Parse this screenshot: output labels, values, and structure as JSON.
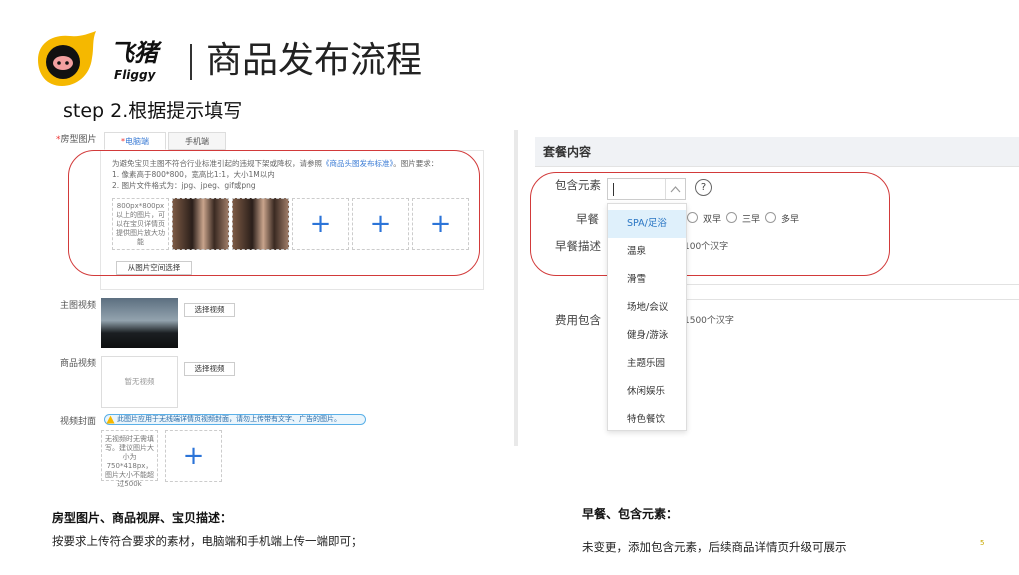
{
  "header": {
    "logo_cn": "飞猪",
    "logo_en": "Fliggy",
    "title": "商品发布流程",
    "step": "step 2.根据提示填写"
  },
  "left_panel": {
    "room_photos_label": "房型图片",
    "required_mark": "*",
    "tabs": [
      "电脑端",
      "手机端"
    ],
    "tab_active_mark": "*",
    "hint_line1_pre": "为避免宝贝主图不符合行业标准引起的违规下架或降权，请参照",
    "hint_link": "《商品头图发布标准》",
    "hint_line1_post": "。图片要求：",
    "hint_line2": "1. 像素高于800*800，宽高比1:1，大小1M以内",
    "hint_line3": "2. 图片文件格式为：jpg、jpeg、gif或png",
    "first_cell_text": "800px*800px以上的图片，可以在宝贝详情页提供图片放大功能",
    "plus_glyph": "+",
    "choose_from_space": "从图片空间选择",
    "main_video_label": "主图视频",
    "choose_video": "选择视频",
    "product_video_label": "商品视频",
    "no_video": "暂无视频",
    "choose_video_2": "选择视频",
    "video_cover_label": "视频封面",
    "warning_text": "此图片应用于无线端详情页视频封面，请勿上传带有文字、广告的图片。",
    "cover_hint": "无视频时无需填写。建议图片大小为750*418px，图片大小不能超过500k"
  },
  "right_panel": {
    "section_title": "套餐内容",
    "include_label": "包含元素",
    "help_glyph": "?",
    "breakfast_label": "早餐",
    "breakfast_options": [
      "双早",
      "三早",
      "多早"
    ],
    "breakfast_desc_label": "早餐描述",
    "breakfast_desc_hint": "100个汉字",
    "fee_label": "费用包含",
    "fee_hint": "1500个汉字",
    "dropdown_items": [
      "SPA/足浴",
      "温泉",
      "滑雪",
      "场地/会议",
      "健身/游泳",
      "主题乐园",
      "休闲娱乐",
      "特色餐饮"
    ],
    "dropdown_selected_index": 0
  },
  "captions": {
    "left_heading": "房型图片、商品视屏、宝贝描述：",
    "left_text": "按要求上传符合要求的素材，电脑端和手机端上传一端即可；",
    "right_heading": "早餐、包含元素：",
    "right_text": "未变更，添加包含元素，后续商品详情页升级可展示"
  },
  "page_number": "5",
  "colors": {
    "accent_blue": "#2b74d8",
    "highlight_red": "#d23a3a",
    "logo_yellow": "#f5b800"
  }
}
